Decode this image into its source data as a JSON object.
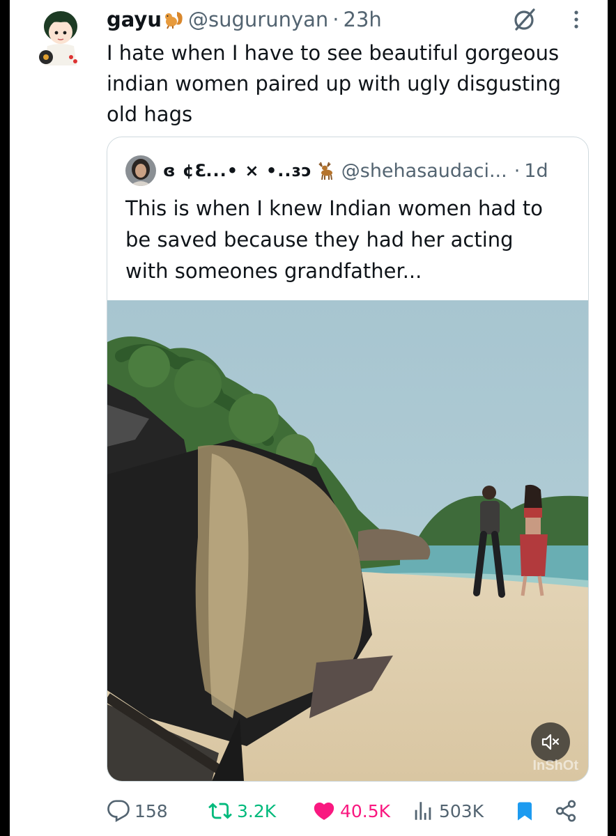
{
  "tweet": {
    "display_name": "gayu",
    "handle": "@sugurunyan",
    "separator": "·",
    "time": "23h",
    "text": "I hate when I have to see beautiful gorgeous\nindian women paired up with ugly disgusting\nold hags"
  },
  "quote": {
    "display_name": "ɞ ¢ℇ...• × •..ɜɔ",
    "handle": "@shehasaudaci...",
    "separator": "·",
    "time": "1d",
    "text": "This is when I knew Indian women had to\nbe saved because they had her acting\nwith someones grandfather...",
    "media": {
      "watermark": "InShOt",
      "muted": true
    }
  },
  "actions": {
    "replies": "158",
    "retweets": "3.2K",
    "likes": "40.5K",
    "views": "503K",
    "bookmarked": true
  },
  "colors": {
    "text": "#0f1419",
    "secondary": "#536471",
    "retweet": "#00ba7c",
    "like": "#f91880",
    "bookmark": "#1d9bf0",
    "border": "#cfd9de"
  },
  "icons": [
    "squirrel-emoji",
    "grok-icon",
    "more-icon",
    "deer-emoji",
    "mute-icon",
    "reply-icon",
    "retweet-icon",
    "heart-icon",
    "views-icon",
    "bookmark-icon",
    "share-icon"
  ]
}
